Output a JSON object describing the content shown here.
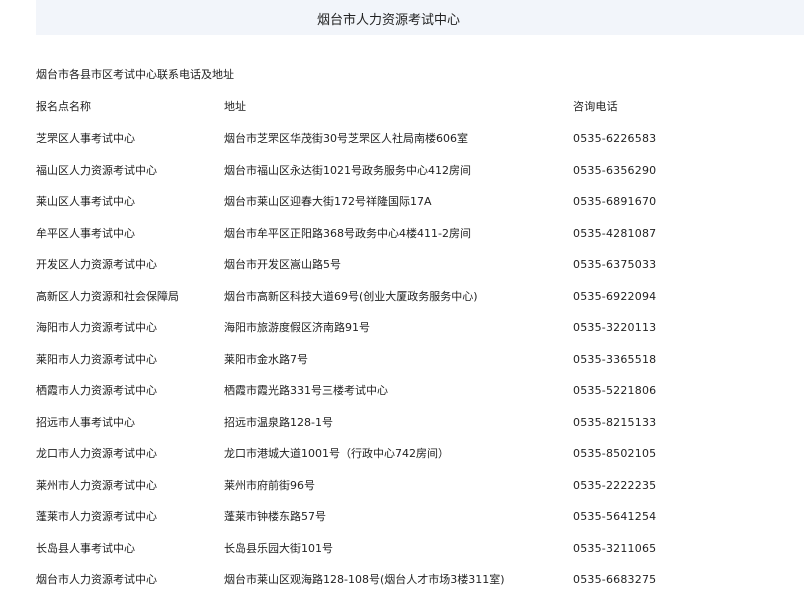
{
  "header": {
    "title": "烟台市人力资源考试中心"
  },
  "section": {
    "title": "烟台市各县市区考试中心联系电话及地址"
  },
  "table": {
    "columns": [
      "报名点名称",
      "地址",
      "咨询电话"
    ],
    "rows": [
      {
        "name": "芝罘区人事考试中心",
        "address": "烟台市芝罘区华茂街30号芝罘区人社局南楼606室",
        "phone": "0535-6226583"
      },
      {
        "name": "福山区人力资源考试中心",
        "address": "烟台市福山区永达街1021号政务服务中心412房间",
        "phone": "0535-6356290"
      },
      {
        "name": "莱山区人事考试中心",
        "address": "烟台市莱山区迎春大街172号祥隆国际17A",
        "phone": "0535-6891670"
      },
      {
        "name": "牟平区人事考试中心",
        "address": "烟台市牟平区正阳路368号政务中心4楼411-2房间",
        "phone": "0535-4281087"
      },
      {
        "name": "开发区人力资源考试中心",
        "address": "烟台市开发区嵩山路5号",
        "phone": "0535-6375033"
      },
      {
        "name": "高新区人力资源和社会保障局",
        "address": "烟台市高新区科技大道69号(创业大厦政务服务中心)",
        "phone": "0535-6922094"
      },
      {
        "name": "海阳市人力资源考试中心",
        "address": "海阳市旅游度假区济南路91号",
        "phone": "0535-3220113"
      },
      {
        "name": "莱阳市人力资源考试中心",
        "address": "莱阳市金水路7号",
        "phone": "0535-3365518"
      },
      {
        "name": "栖霞市人力资源考试中心",
        "address": "栖霞市霞光路331号三楼考试中心",
        "phone": "0535-5221806"
      },
      {
        "name": "招远市人事考试中心",
        "address": "招远市温泉路128-1号",
        "phone": "0535-8215133"
      },
      {
        "name": "龙口市人力资源考试中心",
        "address": "龙口市港城大道1001号（行政中心742房间）",
        "phone": "0535-8502105"
      },
      {
        "name": "莱州市人力资源考试中心",
        "address": "莱州市府前街96号",
        "phone": "0535-2222235"
      },
      {
        "name": "蓬莱市人力资源考试中心",
        "address": "蓬莱市钟楼东路57号",
        "phone": "0535-5641254"
      },
      {
        "name": "长岛县人事考试中心",
        "address": "长岛县乐园大街101号",
        "phone": "0535-3211065"
      },
      {
        "name": "烟台市人力资源考试中心",
        "address": "烟台市莱山区观海路128-108号(烟台人才市场3楼311室)",
        "phone": "0535-6683275"
      }
    ]
  }
}
